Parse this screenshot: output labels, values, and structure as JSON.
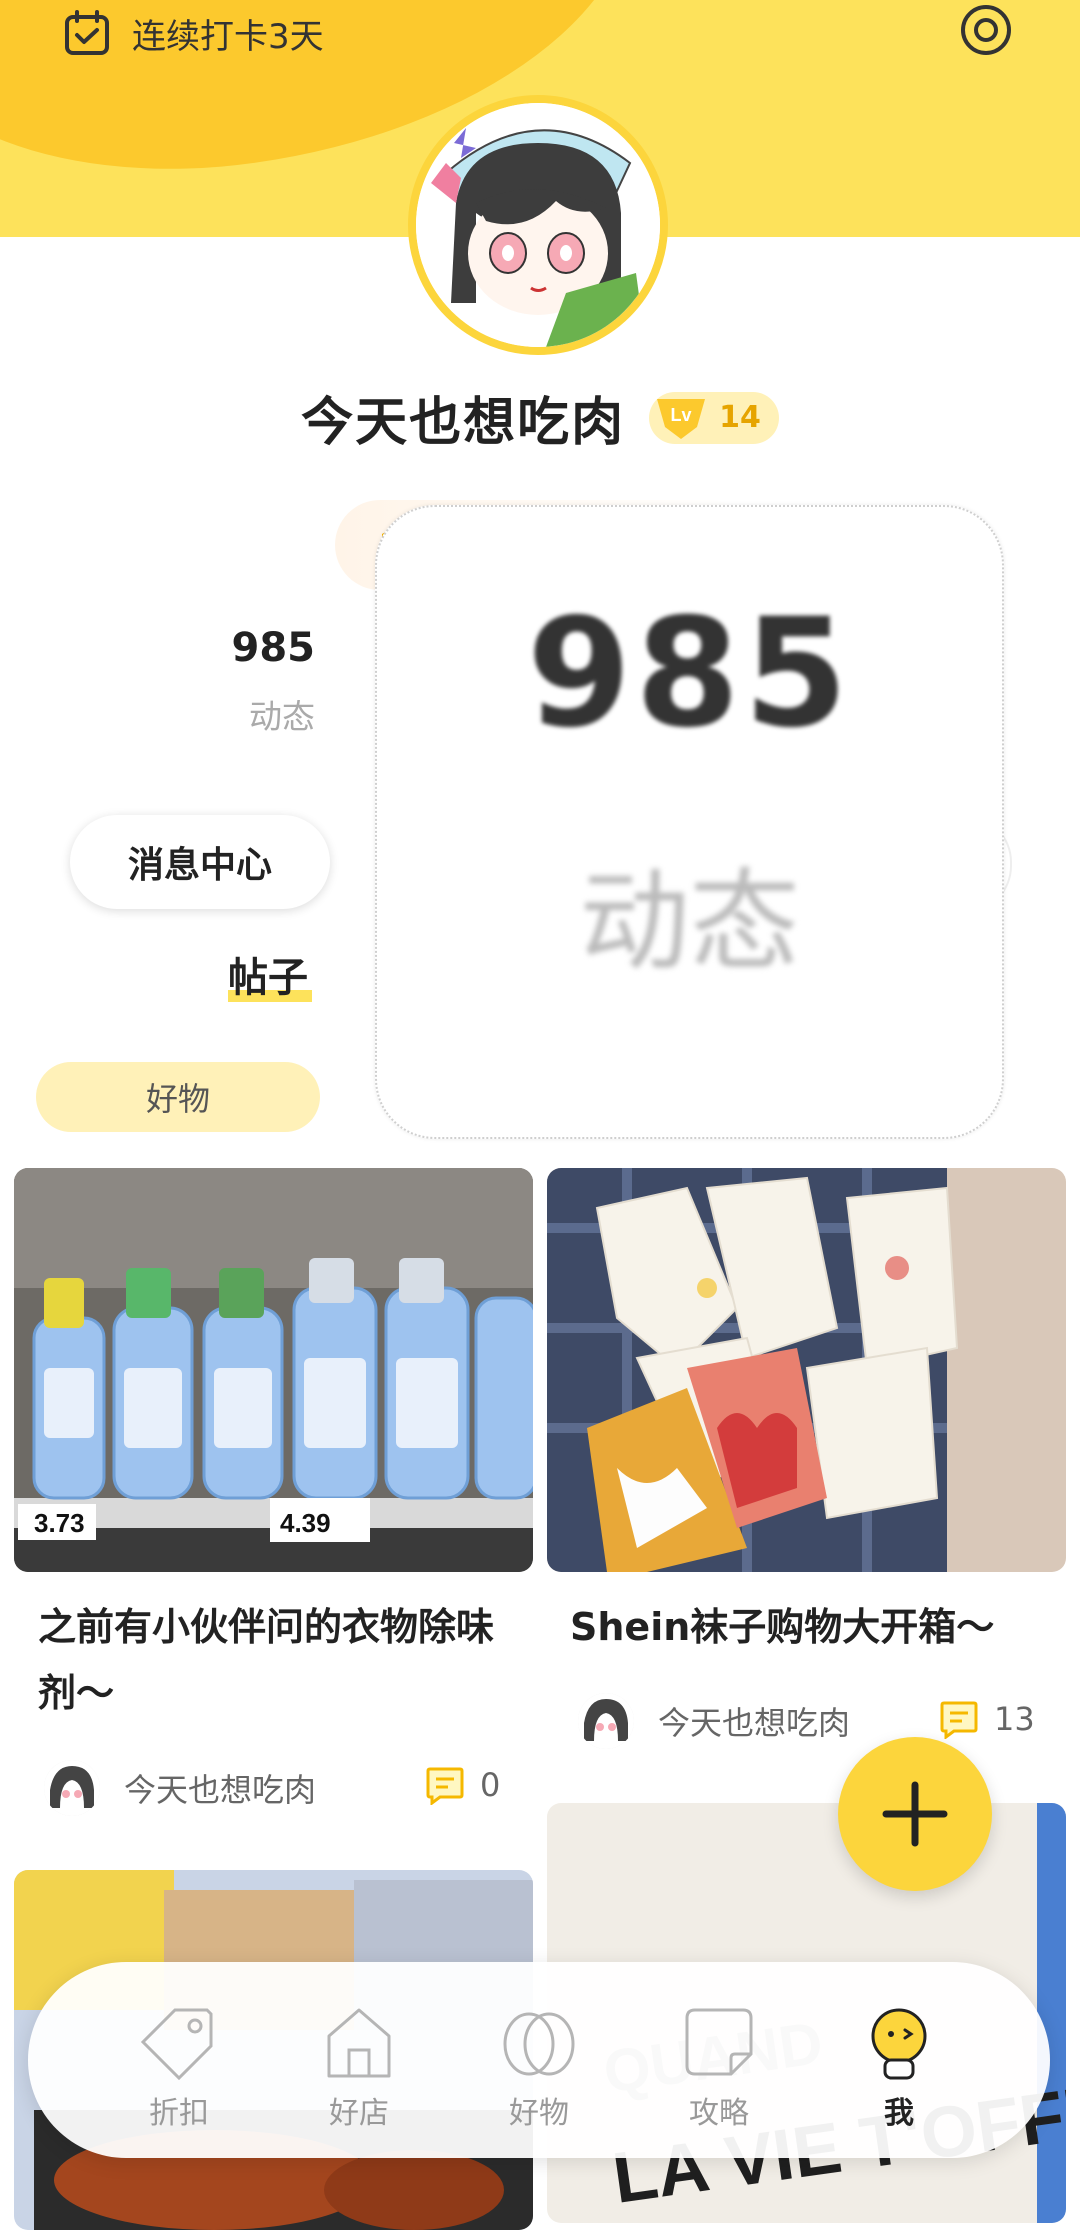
{
  "header": {
    "checkin_text": "连续打卡3天"
  },
  "profile": {
    "username": "今天也想吃肉",
    "level": "14"
  },
  "stats": {
    "value": "985",
    "label": "动态"
  },
  "message_center": "消息中心",
  "tab": "帖子",
  "category_chip": "好物",
  "zoom_preview": {
    "value": "985",
    "label": "动态"
  },
  "feed": [
    {
      "title": "之前有小伙伴问的衣物除味剂～",
      "author": "今天也想吃肉",
      "comments": "0",
      "price_tags": [
        "3.73",
        "4.39"
      ]
    },
    {
      "title": "Shein袜子购物大开箱～",
      "author": "今天也想吃肉",
      "comments": "13"
    }
  ],
  "bottom_nav": [
    {
      "label": "折扣",
      "icon": "tag-icon"
    },
    {
      "label": "好店",
      "icon": "store-icon"
    },
    {
      "label": "好物",
      "icon": "goods-icon"
    },
    {
      "label": "攻略",
      "icon": "guide-icon"
    },
    {
      "label": "我",
      "icon": "me-icon",
      "active": true
    }
  ],
  "colors": {
    "brand_yellow": "#fde25b",
    "accent_yellow": "#fcd53c",
    "text_dark": "#222222"
  }
}
